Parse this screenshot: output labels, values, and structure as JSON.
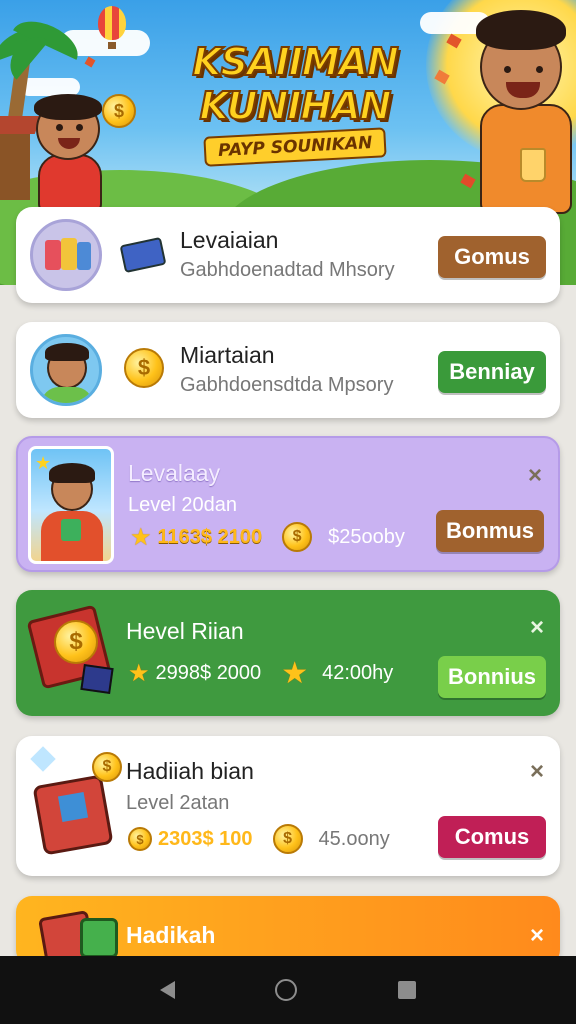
{
  "banner": {
    "title_line1": "KSAIIMAN",
    "title_line2": "KUNIHAN",
    "subtitle": "PAYP SOUNIKAN"
  },
  "cards": [
    {
      "title": "Levaiaian",
      "subtitle": "Gabhdoenadtad Mhsory",
      "button": "Gomus",
      "button_color": "#a0622e"
    },
    {
      "title": "Miartaian",
      "subtitle": "Gabhdoensdtda Mpsory",
      "button": "Benniay",
      "button_color": "#3a9a3a"
    },
    {
      "title": "Levalaay",
      "subtitle": "Level 20dan",
      "stat1": "1163$ 2100",
      "stat2": "$25ooby",
      "button": "Bonmus",
      "button_color": "#a0622e",
      "close": "×"
    },
    {
      "title": "Hevel Riian",
      "stat1": "2998$ 2000",
      "stat2": "42:00hy",
      "button": "Bonnius",
      "button_color": "#79cf4a",
      "close": "×"
    },
    {
      "title": "Hadiiah bian",
      "subtitle": "Level 2atan",
      "stat1": "2303$ 100",
      "stat2": "45.oony",
      "button": "Comus",
      "button_color": "#c01f56",
      "close": "×"
    },
    {
      "title": "Hadikah",
      "close": "×"
    }
  ],
  "icons": {
    "back": "triangle-back-icon",
    "home": "circle-home-icon",
    "recent": "square-recent-icon"
  }
}
